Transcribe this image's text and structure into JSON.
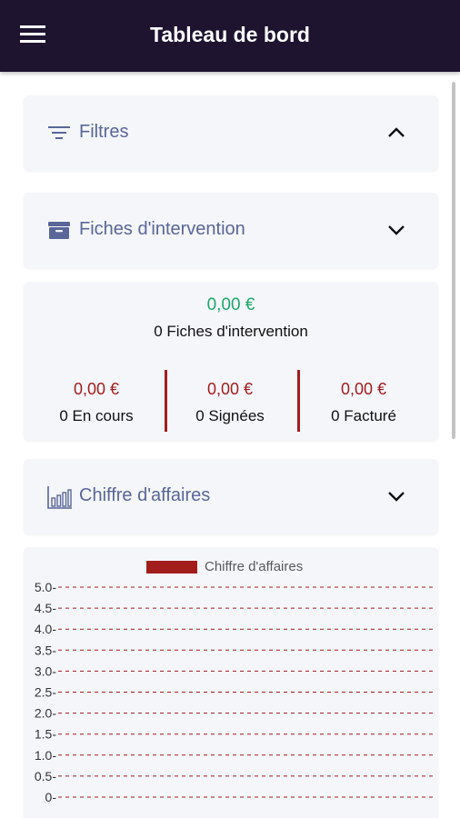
{
  "appbar": {
    "title": "Tableau de bord",
    "menu_icon": "hamburger-menu-icon",
    "background": "#1e1430"
  },
  "filters": {
    "title": "Filtres",
    "icon": "filter-icon",
    "state": "expanded"
  },
  "interventions": {
    "title": "Fiches d'intervention",
    "icon": "inbox-tray-icon",
    "state": "collapsed"
  },
  "summary": {
    "total_amount": "0,00 €",
    "total_label": "0 Fiches d'intervention",
    "stats": [
      {
        "amount": "0,00 €",
        "label": "0 En cours"
      },
      {
        "amount": "0,00 €",
        "label": "0 Signées"
      },
      {
        "amount": "0,00 €",
        "label": "0 Facturé"
      }
    ]
  },
  "revenue": {
    "title": "Chiffre d'affaires",
    "icon": "bar-chart-icon",
    "state": "collapsed"
  },
  "colors": {
    "accent_text": "#5a6699",
    "positive": "#1ea86b",
    "status_red": "#a31d1d",
    "card_bg": "#f4f6fa"
  },
  "chart_data": {
    "type": "bar",
    "legend": [
      "Chiffre d'affaires"
    ],
    "legend_position": "top-center",
    "series": [
      {
        "name": "Chiffre d'affaires",
        "values": [],
        "color": "#a31d1d"
      }
    ],
    "categories": [],
    "yticks": [
      "5.0",
      "4.5",
      "4.0",
      "3.5",
      "3.0",
      "2.5",
      "2.0",
      "1.5",
      "1.0",
      "0.5",
      "0"
    ],
    "ylim": [
      0,
      5
    ],
    "grid": true
  }
}
